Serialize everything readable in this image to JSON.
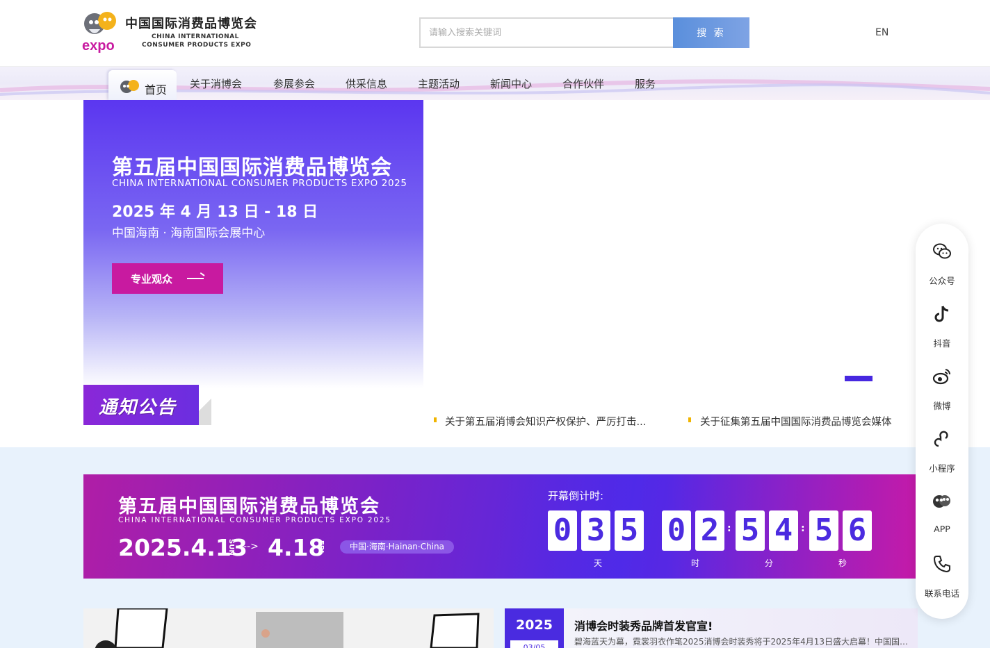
{
  "header": {
    "logo_cn": "中国国际消费品博览会",
    "logo_en_line1": "CHINA INTERNATIONAL",
    "logo_en_line2": "CONSUMER PRODUCTS EXPO",
    "logo_expo": "expo",
    "search_placeholder": "请输入搜索关键词",
    "search_button": "搜 索",
    "lang": "EN"
  },
  "nav": {
    "home": "首页",
    "items": [
      "关于消博会",
      "参展参会",
      "供采信息",
      "主题活动",
      "新闻中心",
      "合作伙伴",
      "服务"
    ]
  },
  "hero": {
    "title": "第五届中国国际消费品博览会",
    "subtitle": "CHINA INTERNATIONAL CONSUMER PRODUCTS EXPO 2025",
    "date": "2025 年 4 月 13 日 - 18 日",
    "venue": "中国海南 · 海南国际会展中心",
    "button": "专业观众"
  },
  "notice": {
    "label": "通知公告",
    "items": [
      "关于第五届消博会知识产权保护、严厉打击...",
      "关于征集第五届中国国际消费品博览会媒体"
    ]
  },
  "banner": {
    "title": "第五届中国国际消费品博览会",
    "subtitle": "CHINA INTERNATIONAL CONSUMER PRODUCTS EXPO 2025",
    "start_date": "2025.4.13",
    "start_dow": "SUN",
    "arrow": "-->",
    "end_date": "4.18",
    "end_dow": "FRI",
    "location": "中国·海南·Hainan·China",
    "countdown_label": "开幕倒计时:",
    "days_digits": [
      "0",
      "3",
      "5"
    ],
    "hours_digits": [
      "0",
      "2"
    ],
    "minutes_digits": [
      "5",
      "4"
    ],
    "seconds_digits": [
      "5",
      "6"
    ],
    "unit_day": "天",
    "unit_hour": "时",
    "unit_minute": "分",
    "unit_second": "秒"
  },
  "side_panel": {
    "items": [
      {
        "label": "公众号",
        "icon": "wechat-icon"
      },
      {
        "label": "抖音",
        "icon": "tiktok-icon"
      },
      {
        "label": "微博",
        "icon": "weibo-icon"
      },
      {
        "label": "小程序",
        "icon": "mini-program-icon"
      },
      {
        "label": "APP",
        "icon": "app-icon"
      },
      {
        "label": "联系电话",
        "icon": "phone-icon"
      }
    ]
  },
  "news": {
    "year": "2025",
    "date": "03/05",
    "title": "消博会时装秀品牌首发官宣!",
    "description": "碧海蓝天为幕，霓裳羽衣作笔2025消博会时装秀将于2025年4月13日盛大启幕！中国国际..."
  },
  "colors": {
    "brand_purple": "#4b2be0",
    "brand_magenta": "#c81aa0",
    "accent_yellow": "#f0b400"
  }
}
